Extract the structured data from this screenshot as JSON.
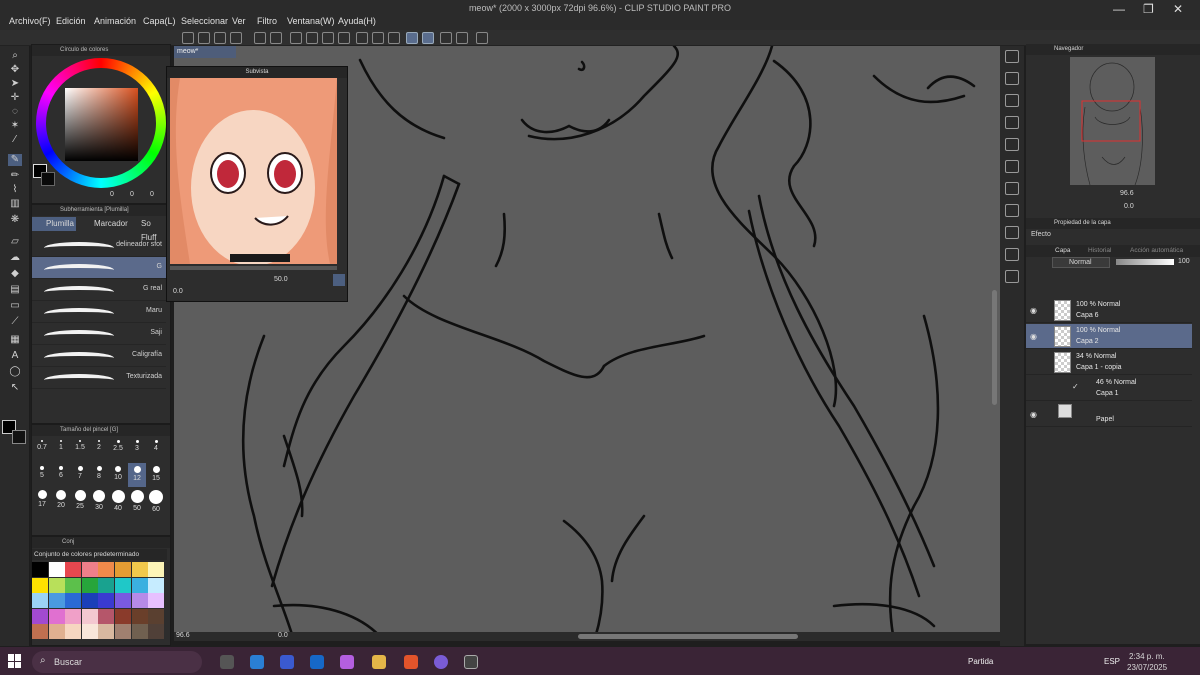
{
  "window": {
    "title": "meow* (2000 x 3000px 72dpi 96.6%) - CLIP STUDIO PAINT PRO",
    "controls": [
      "—",
      "❐",
      "✕"
    ]
  },
  "menu": [
    "Archivo(F)",
    "Edición",
    "Animación",
    "Capa(L)",
    "Seleccionar",
    "Ver",
    "Filtro",
    "Ventana(W)",
    "Ayuda(H)"
  ],
  "color_panel": {
    "title": "Círculo de colores",
    "values": [
      "0",
      "0",
      "0"
    ]
  },
  "subtool_panel": {
    "title": "Subherramienta [Plumilla]",
    "tabs": [
      "Plumilla",
      "Marcador",
      "So Fluff"
    ],
    "brushes": [
      "delineador sfot",
      "G",
      "G real",
      "Maru",
      "Saji",
      "Caligrafía",
      "Texturizada"
    ],
    "selected_index": 1
  },
  "brush_size_panel": {
    "title": "Tamaño del pincel [G]",
    "sizes": [
      "0.7",
      "1",
      "1.5",
      "2",
      "2.5",
      "3",
      "4",
      "5",
      "6",
      "7",
      "8",
      "10",
      "12",
      "15",
      "17",
      "20",
      "25",
      "30",
      "40",
      "50",
      "60"
    ],
    "selected": "12"
  },
  "palette_panel": {
    "tab": "Conj",
    "dropdown": "Conjunto de colores predeterminado",
    "colors": [
      "#000000",
      "#ffffff",
      "#e7474f",
      "#ef7f8a",
      "#f08a4b",
      "#e59c33",
      "#f2c94c",
      "#fdf5b8",
      "#ffe100",
      "#b8e05a",
      "#5cc04b",
      "#27a53b",
      "#19a28f",
      "#1fc8c8",
      "#3bb0e0",
      "#c6ecff",
      "#9bd3f5",
      "#4a9ae0",
      "#2a6ad5",
      "#1b3fb8",
      "#3a3ad0",
      "#7a5ae0",
      "#b68ae8",
      "#e7c0ff",
      "#a24ad0",
      "#e070d0",
      "#f0a0c8",
      "#f3c7d0",
      "#b5566a",
      "#8a3b2b",
      "#6a3f2a",
      "#5a4030",
      "#c07050",
      "#e0b090",
      "#f6d6c0",
      "#f8e6da",
      "#d8b8a0",
      "#a08070",
      "#706050",
      "#504038"
    ]
  },
  "canvas": {
    "tab_label": "meow*",
    "zoom": "96.6",
    "rotation": "0.0"
  },
  "subview": {
    "title": "Subvista",
    "zoom": "50.0",
    "rotation": "0.0"
  },
  "navigator": {
    "title": "Navegador",
    "zoom": "96.6",
    "rotation": "0.0"
  },
  "layer_property": {
    "title": "Propiedad de la capa",
    "effect_label": "Efecto"
  },
  "layer_panel": {
    "tabs": [
      "Capa",
      "Historial",
      "Acción automática"
    ],
    "blend_mode": "Normal",
    "opacity": "100",
    "layers": [
      {
        "mode": "100 % Normal",
        "name": "Capa 6",
        "visible": true,
        "selected": false
      },
      {
        "mode": "100 % Normal",
        "name": "Capa 2",
        "visible": true,
        "selected": true
      },
      {
        "mode": "34 % Normal",
        "name": "Capa 1 - copia",
        "visible": false,
        "selected": false
      },
      {
        "mode": "46 % Normal",
        "name": "Capa 1",
        "visible": false,
        "selected": false
      },
      {
        "mode": "",
        "name": "Papel",
        "visible": true,
        "selected": false
      }
    ]
  },
  "taskbar": {
    "search_placeholder": "Buscar",
    "weather": "Partida",
    "language": "ESP",
    "time": "2:34 p. m.",
    "date": "23/07/2025"
  },
  "colors": {
    "accent": "#5b6a8b",
    "canvas_bg": "#5d5d5d",
    "panel_bg": "#2d2d2d",
    "taskbar_bg": "#3a2436"
  }
}
